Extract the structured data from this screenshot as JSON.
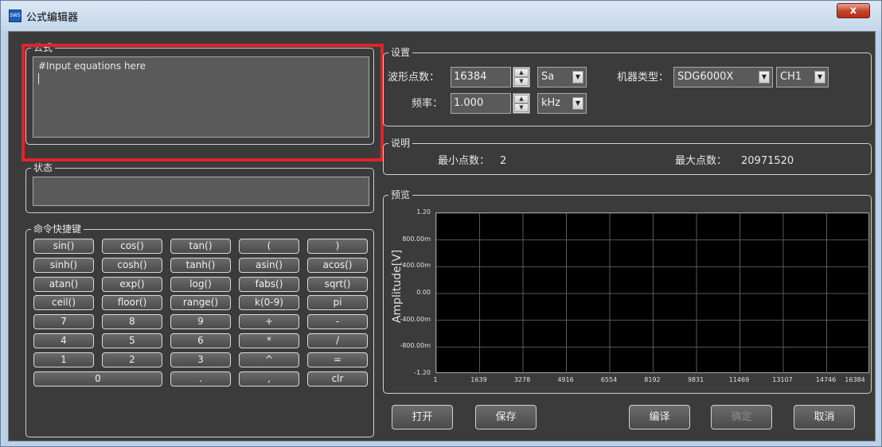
{
  "window": {
    "title": "公式编辑器",
    "app_icon_text": "SWS",
    "close_glyph": "x"
  },
  "formula": {
    "group_title": "公式",
    "text": "#Input equations here"
  },
  "status": {
    "group_title": "状态"
  },
  "commands": {
    "group_title": "命令快捷键",
    "rows": [
      [
        "sin()",
        "cos()",
        "tan()",
        "(",
        ")"
      ],
      [
        "sinh()",
        "cosh()",
        "tanh()",
        "asin()",
        "acos()"
      ],
      [
        "atan()",
        "exp()",
        "log()",
        "fabs()",
        "sqrt()"
      ],
      [
        "ceil()",
        "floor()",
        "range()",
        "k(0-9)",
        "pi"
      ],
      [
        "7",
        "8",
        "9",
        "+",
        "-"
      ],
      [
        "4",
        "5",
        "6",
        "*",
        "/"
      ],
      [
        "1",
        "2",
        "3",
        "^",
        "="
      ]
    ],
    "last_row": [
      "0",
      ".",
      ",",
      "clr"
    ]
  },
  "settings": {
    "group_title": "设置",
    "points_label": "波形点数：",
    "points_value": "16384",
    "points_unit": "Sa",
    "freq_label": "频率：",
    "freq_value": "1.000",
    "freq_unit": "kHz",
    "machine_label": "机器类型：",
    "machine_value": "SDG6000X",
    "channel_value": "CH1"
  },
  "info": {
    "group_title": "说明",
    "min_label": "最小点数：",
    "min_value": "2",
    "max_label": "最大点数：",
    "max_value": "20971520"
  },
  "preview": {
    "group_title": "预览",
    "y_ticks": [
      "1.20",
      "800.00m",
      "400.00m",
      "0.00",
      "-400.00m",
      "-800.00m",
      "-1.20"
    ],
    "x_ticks": [
      "1",
      "1639",
      "3278",
      "4916",
      "6554",
      "8192",
      "9831",
      "11469",
      "13107",
      "14746",
      "16384"
    ]
  },
  "chart_data": {
    "type": "line",
    "title": "",
    "xlabel": "",
    "ylabel": "Amplitude[V]",
    "xlim": [
      1,
      16384
    ],
    "ylim": [
      -1.2,
      1.2
    ],
    "x_ticks": [
      1,
      1639,
      3278,
      4916,
      6554,
      8192,
      9831,
      11469,
      13107,
      14746,
      16384
    ],
    "y_ticks": [
      1.2,
      0.8,
      0.4,
      0.0,
      -0.4,
      -0.8,
      -1.2
    ],
    "grid": true,
    "series": []
  },
  "actions": {
    "open": "打开",
    "save": "保存",
    "compile": "编译",
    "ok": "确定",
    "cancel": "取消"
  },
  "colors": {
    "highlight": "#e0232a",
    "background": "#3b3b3b",
    "plot_bg": "#000000",
    "grid": "#5a5a5a"
  }
}
